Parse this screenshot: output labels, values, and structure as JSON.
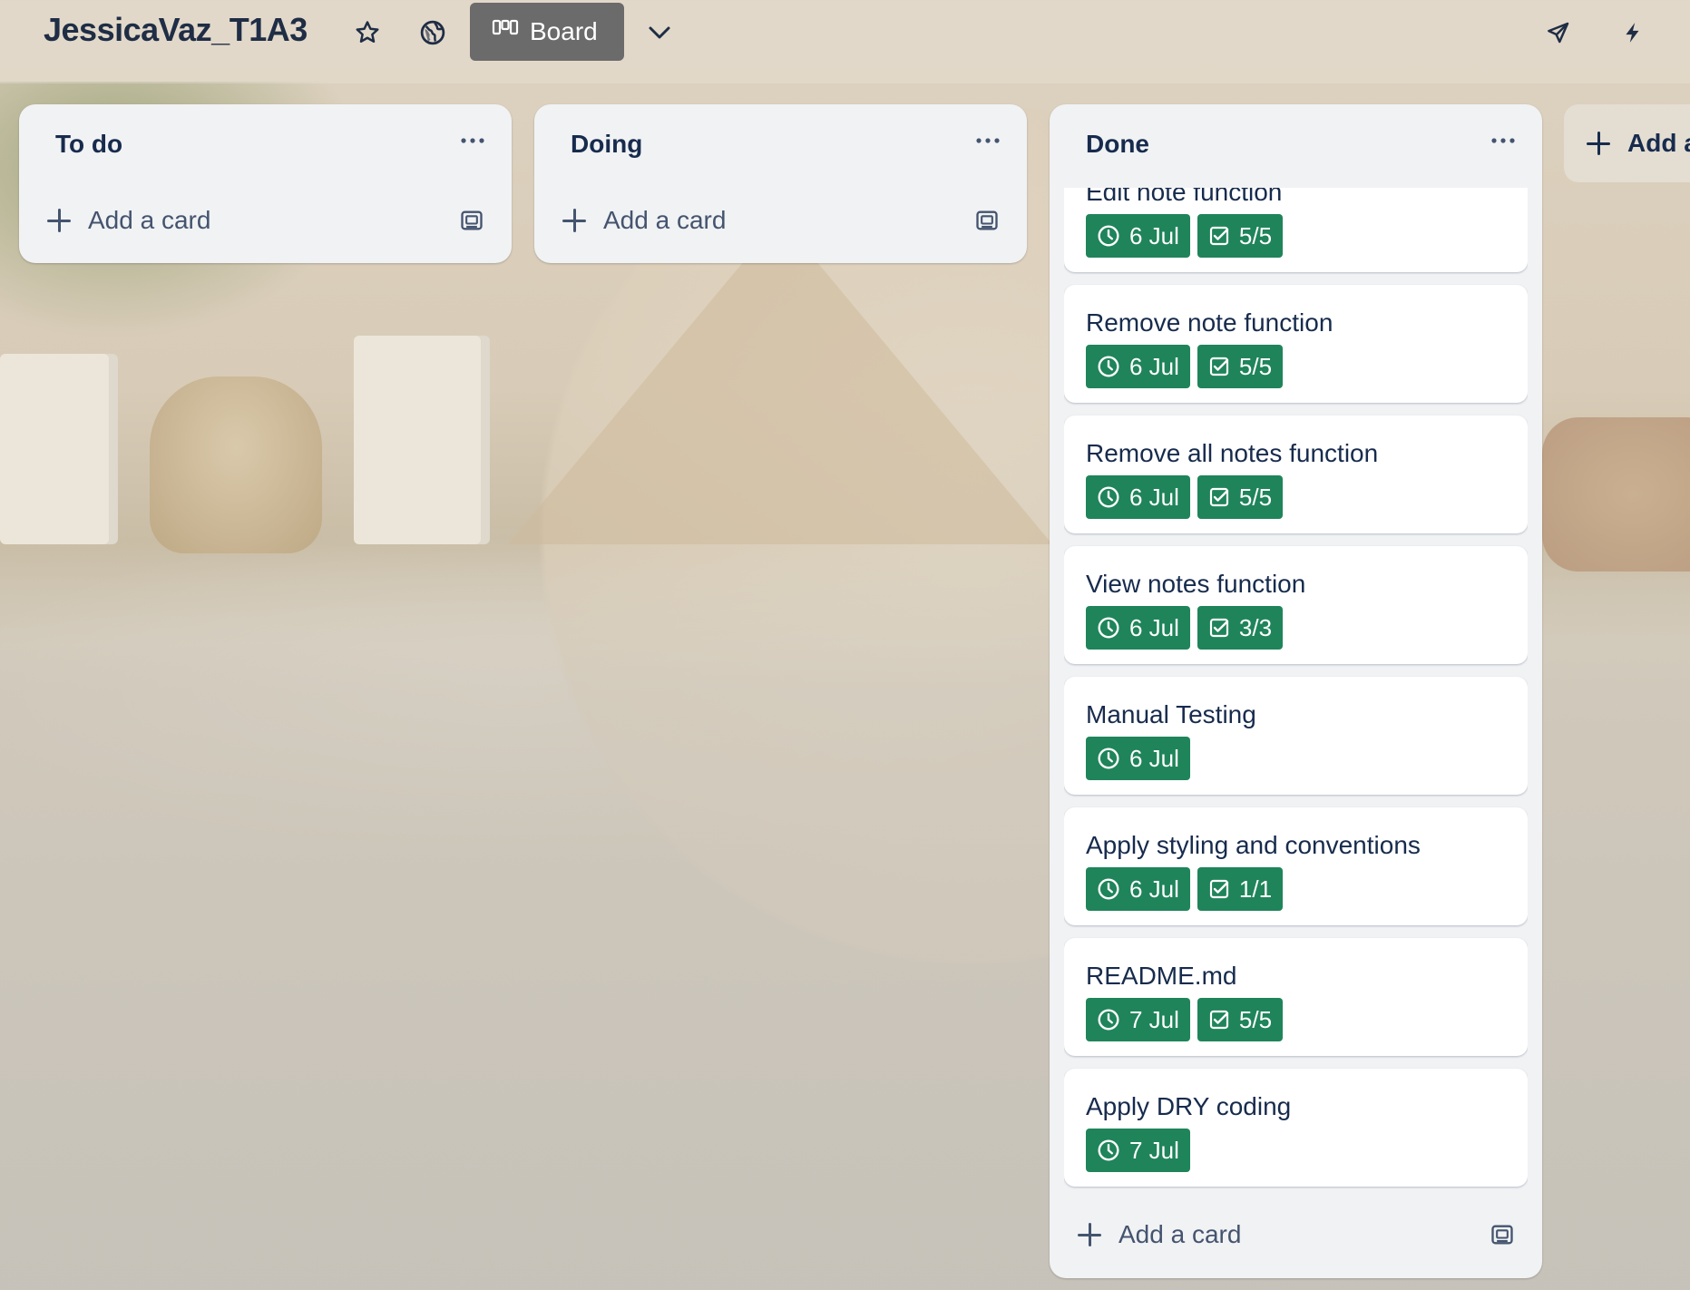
{
  "header": {
    "board_title": "JessicaVaz_T1A3",
    "view_label": "Board",
    "icons": [
      "star-icon",
      "globe-icon",
      "board-view-icon",
      "chevron-down-icon",
      "rocket-icon",
      "lightning-icon"
    ]
  },
  "lists": [
    {
      "title": "To do",
      "add_card_label": "Add a card"
    },
    {
      "title": "Doing",
      "add_card_label": "Add a card"
    },
    {
      "title": "Done",
      "add_card_label": "Add a card",
      "cards": [
        {
          "title": "Edit note function",
          "date": "6 Jul",
          "checklist": "5/5"
        },
        {
          "title": "Remove note function",
          "date": "6 Jul",
          "checklist": "5/5"
        },
        {
          "title": "Remove all notes function",
          "date": "6 Jul",
          "checklist": "5/5"
        },
        {
          "title": "View notes function",
          "date": "6 Jul",
          "checklist": "3/3"
        },
        {
          "title": "Manual Testing",
          "date": "6 Jul"
        },
        {
          "title": "Apply styling and conventions",
          "date": "6 Jul",
          "checklist": "1/1"
        },
        {
          "title": "README.md",
          "date": "7 Jul",
          "checklist": "5/5"
        },
        {
          "title": "Apply DRY coding",
          "date": "7 Jul"
        }
      ]
    }
  ],
  "add_list_label": "Add another list",
  "colors": {
    "badge_green": "#1f845a",
    "list_bg": "#f1f2f4",
    "text_primary": "#172b4d",
    "text_secondary": "#44546f"
  }
}
